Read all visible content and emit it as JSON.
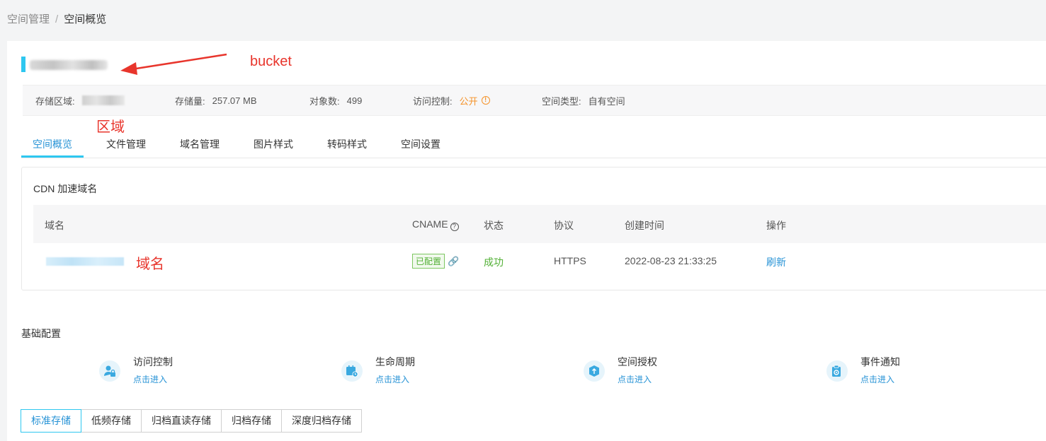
{
  "breadcrumb": {
    "parent": "空间管理",
    "separator": "/",
    "current": "空间概览"
  },
  "annotations": {
    "bucket": "bucket",
    "region": "区域",
    "domain": "域名"
  },
  "info": {
    "region_label": "存储区域:",
    "storage_label": "存储量:",
    "storage_value": "257.07 MB",
    "objects_label": "对象数:",
    "objects_value": "499",
    "access_label": "访问控制:",
    "access_value": "公开",
    "type_label": "空间类型:",
    "type_value": "自有空间"
  },
  "tabs": [
    "空间概览",
    "文件管理",
    "域名管理",
    "图片样式",
    "转码样式",
    "空间设置"
  ],
  "cdn": {
    "title": "CDN 加速域名",
    "headers": {
      "domain": "域名",
      "cname": "CNAME",
      "status": "状态",
      "protocol": "协议",
      "created": "创建时间",
      "action": "操作"
    },
    "row": {
      "cname": "已配置",
      "status": "成功",
      "protocol": "HTTPS",
      "created": "2022-08-23 21:33:25",
      "action": "刷新"
    }
  },
  "basic": {
    "title": "基础配置",
    "features": [
      {
        "name": "访问控制",
        "link": "点击进入",
        "icon": "user-lock-icon"
      },
      {
        "name": "生命周期",
        "link": "点击进入",
        "icon": "calendar-clock-icon"
      },
      {
        "name": "空间授权",
        "link": "点击进入",
        "icon": "box-upload-icon"
      },
      {
        "name": "事件通知",
        "link": "点击进入",
        "icon": "clipboard-gear-icon"
      }
    ]
  },
  "storage_classes": [
    "标准存储",
    "低频存储",
    "归档直读存储",
    "归档存储",
    "深度归档存储"
  ],
  "colors": {
    "accent": "#2ec7f0",
    "link": "#2793d6",
    "success": "#52b035",
    "warning": "#f5932a",
    "annotation": "#e8352c"
  }
}
